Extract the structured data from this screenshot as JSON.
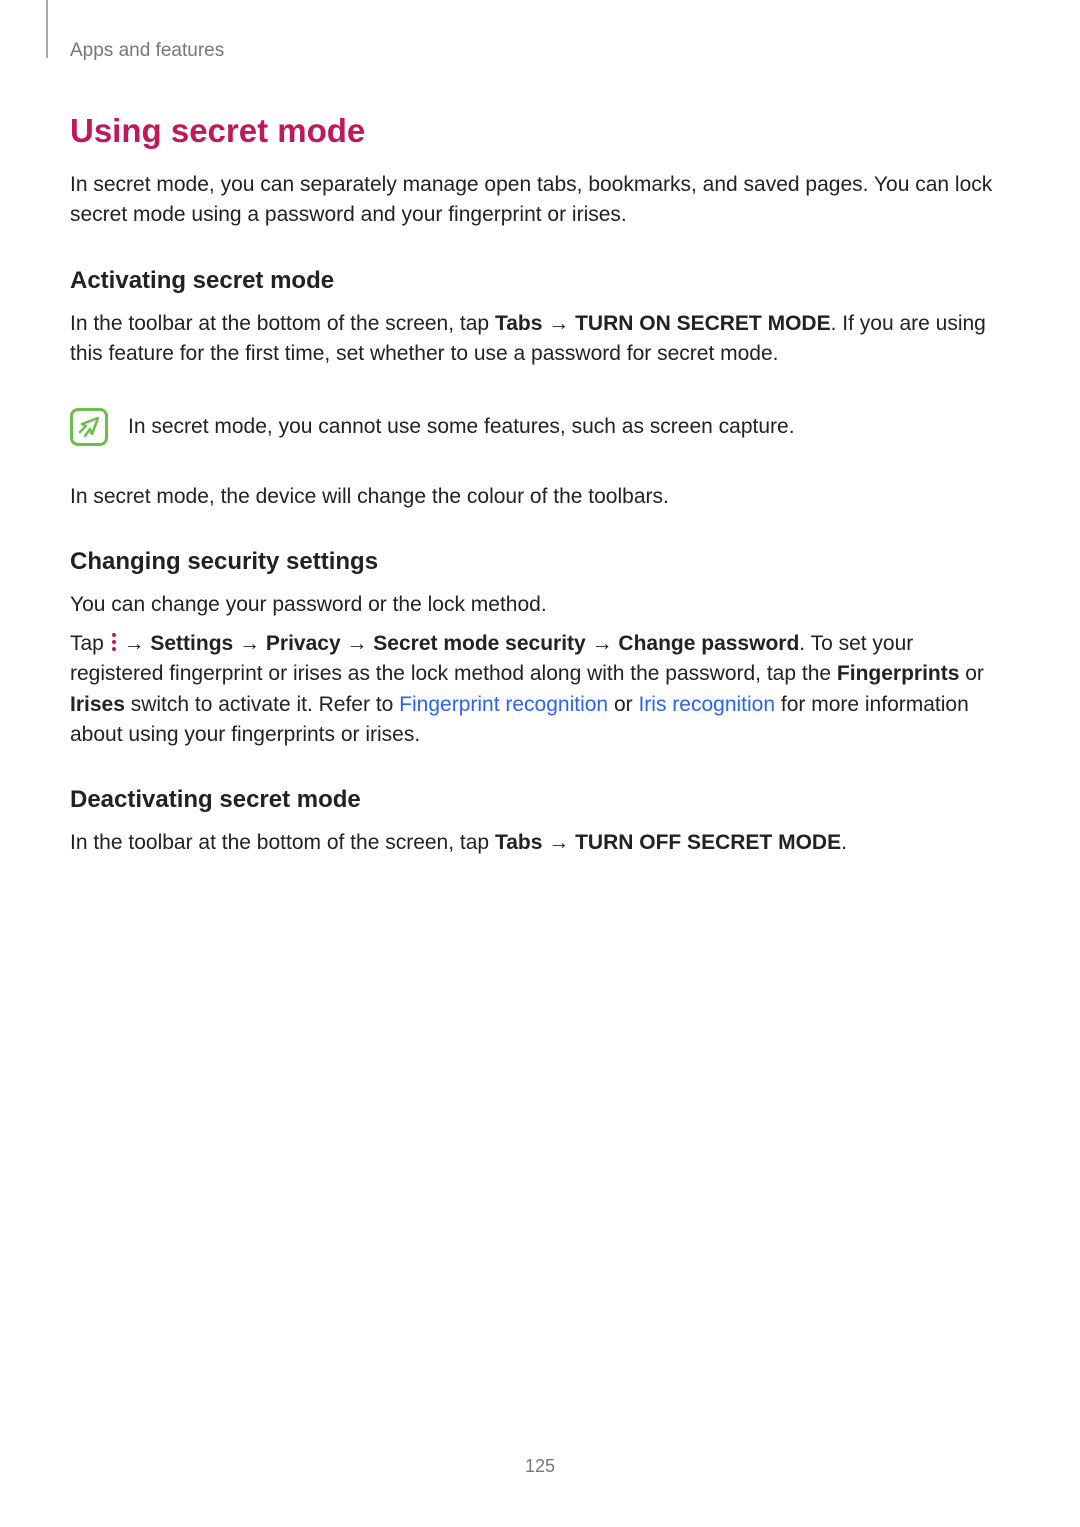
{
  "header": {
    "breadcrumb": "Apps and features"
  },
  "title": "Using secret mode",
  "intro": "In secret mode, you can separately manage open tabs, bookmarks, and saved pages. You can lock secret mode using a password and your fingerprint or irises.",
  "section1": {
    "heading": "Activating secret mode",
    "p1a": "In the toolbar at the bottom of the screen, tap ",
    "p1b_bold": "Tabs",
    "p1c": " → ",
    "p1d_bold": "TURN ON SECRET MODE",
    "p1e": ". If you are using this feature for the first time, set whether to use a password for secret mode.",
    "note": "In secret mode, you cannot use some features, such as screen capture.",
    "p2": "In secret mode, the device will change the colour of the toolbars."
  },
  "section2": {
    "heading": "Changing security settings",
    "p1": "You can change your password or the lock method.",
    "tap_prefix": "Tap ",
    "settings": "Settings",
    "privacy": "Privacy",
    "secret_mode_security": "Secret mode security",
    "change_password": "Change password",
    "tap_suffix1": ". To set your registered fingerprint or irises as the lock method along with the password, tap the ",
    "fingerprints": "Fingerprints",
    "or1": " or ",
    "irises": "Irises",
    "tap_suffix2": " switch to activate it. Refer to ",
    "link1": "Fingerprint recognition",
    "or2": " or ",
    "link2": "Iris recognition",
    "tap_suffix3": " for more information about using your fingerprints or irises.",
    "arrow": " → "
  },
  "section3": {
    "heading": "Deactivating secret mode",
    "p1a": "In the toolbar at the bottom of the screen, tap ",
    "p1b_bold": "Tabs",
    "p1c": " → ",
    "p1d_bold": "TURN OFF SECRET MODE",
    "p1e": "."
  },
  "page_number": "125"
}
